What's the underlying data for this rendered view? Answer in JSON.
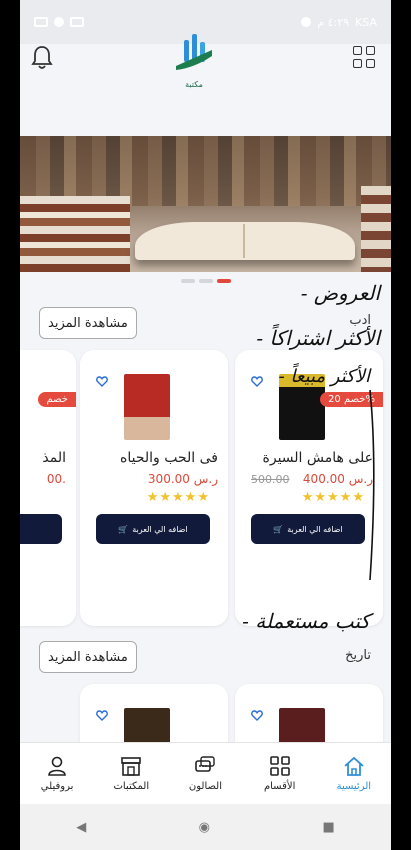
{
  "status_bar": {
    "carrier": "KSA",
    "time": "٤:٢٩ م"
  },
  "header": {
    "logo_text": "مكتبة"
  },
  "banner": {
    "slide_count": 3,
    "active_index": 2
  },
  "sections": [
    {
      "title": "ادب",
      "more_label": "مشاهدة المزيد",
      "cards": [
        {
          "title": "على هامش السيرة",
          "price": "400.00 ر.س",
          "old_price": "500.00",
          "discount": "خصم 20%",
          "rating": 5,
          "cart_label": "اضافه الي العربة"
        },
        {
          "title": "فى الحب والحياه",
          "price": "300.00 ر.س",
          "rating": 5,
          "cart_label": "اضافه الي العربة"
        },
        {
          "title": "المذ",
          "price": "00.",
          "discount": "خصم"
        }
      ]
    },
    {
      "title": "تاريخ",
      "more_label": "مشاهدة المزيد"
    }
  ],
  "annotations": [
    "- العروض",
    "- الأكثر اشتراكاً",
    "- الأكثر مبيعاً",
    "- كتب مستعملة"
  ],
  "bottom_nav": [
    {
      "label": "الرئيسية",
      "icon": "home-icon",
      "active": true
    },
    {
      "label": "الأقسام",
      "icon": "grid-icon"
    },
    {
      "label": "الصالون",
      "icon": "chat-icon"
    },
    {
      "label": "المكتبات",
      "icon": "store-icon"
    },
    {
      "label": "بروفيلي",
      "icon": "user-icon"
    }
  ],
  "colors": {
    "accent": "#2e8fd8",
    "price": "#d94a3a",
    "cart": "#111a3b",
    "badge": "#e44a3d",
    "star": "#f3c12a"
  }
}
